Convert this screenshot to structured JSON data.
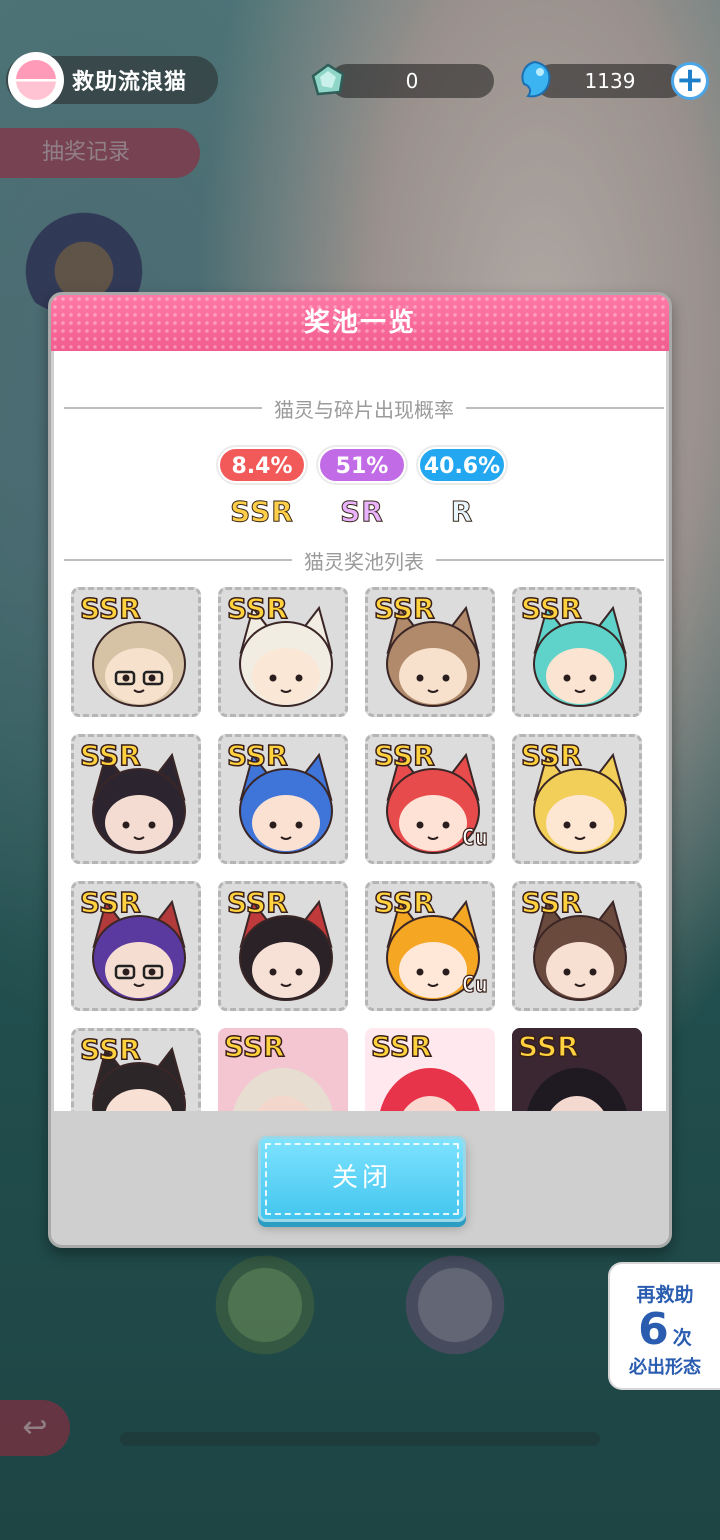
{
  "header": {
    "title": "救助流浪猫",
    "shards": "0",
    "gems": "1139"
  },
  "background": {
    "record_label": "抽奖记录",
    "back_label": "↩"
  },
  "modal": {
    "title": "奖池一览",
    "section_rates": "猫灵与碎片出现概率",
    "rates": [
      {
        "value": "8.4%",
        "tier": "SSR",
        "color": "#f25a5a",
        "label_color": "#ffcf4a"
      },
      {
        "value": "51%",
        "tier": "SR",
        "color": "#c26be6",
        "label_color": "#e9b3ff"
      },
      {
        "value": "40.6%",
        "tier": "R",
        "color": "#22a7f0",
        "label_color": "#e8f7ff"
      }
    ],
    "section_pool": "猫灵奖池列表",
    "pool": [
      {
        "rarity": "SSR",
        "icon": "cat-avatar-glasses-man"
      },
      {
        "rarity": "SSR",
        "icon": "cat-avatar-white-hair-girl"
      },
      {
        "rarity": "SSR",
        "icon": "cat-avatar-brown-cat-girl"
      },
      {
        "rarity": "SSR",
        "icon": "cat-avatar-teal-hair-girl"
      },
      {
        "rarity": "SSR",
        "icon": "cat-avatar-black-cat-girl-bandaged"
      },
      {
        "rarity": "SSR",
        "icon": "cat-avatar-blue-cat-girl"
      },
      {
        "rarity": "SSR",
        "icon": "cat-avatar-red-pixel-cat",
        "badge": "Cu"
      },
      {
        "rarity": "SSR",
        "icon": "cat-avatar-blonde-sailor-girl"
      },
      {
        "rarity": "SSR",
        "icon": "cat-avatar-purple-hair-glasses"
      },
      {
        "rarity": "SSR",
        "icon": "cat-avatar-black-hair-red-bow"
      },
      {
        "rarity": "SSR",
        "icon": "cat-avatar-orange-pixel-cat",
        "badge": "Cu"
      },
      {
        "rarity": "SSR",
        "icon": "cat-avatar-brown-short-hair"
      },
      {
        "rarity": "SSR",
        "icon": "cat-avatar-black-hair-orange"
      },
      {
        "rarity": "SSR",
        "icon": "photo-glasses-white-hair"
      },
      {
        "rarity": "SSR",
        "icon": "photo-red-hair-girl"
      },
      {
        "rarity": "SSR",
        "icon": "photo-black-hair-girl"
      }
    ],
    "close_label": "关闭"
  },
  "reminder": {
    "line1": "再救助",
    "count": "6",
    "unit": "次",
    "line3": "必出形态"
  }
}
